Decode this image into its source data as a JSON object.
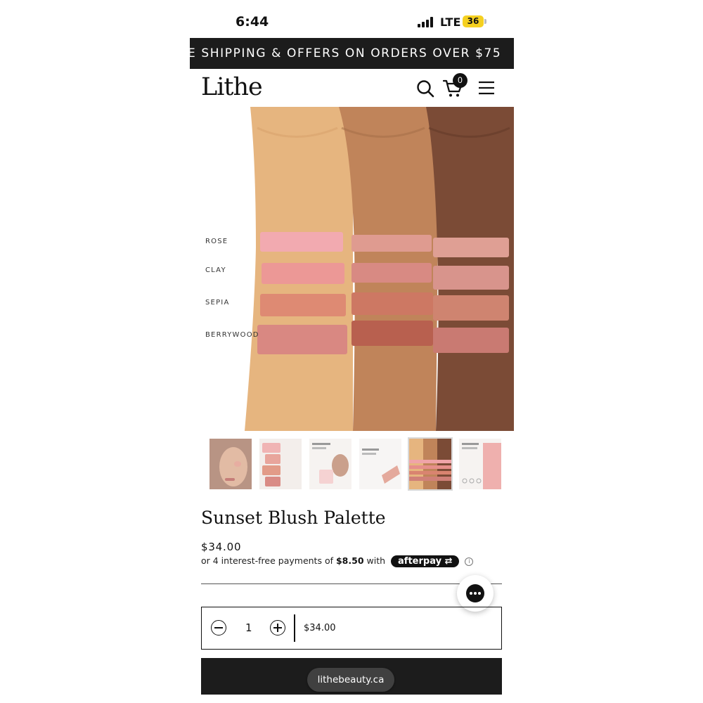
{
  "status_bar": {
    "time": "6:44",
    "network": "LTE",
    "battery": "36"
  },
  "announcement": {
    "text": "E SHIPPING & OFFERS ON ORDERS OVER $75"
  },
  "header": {
    "logo": "Lithe",
    "cart_count": "0"
  },
  "hero": {
    "swatch_labels": [
      "ROSE",
      "CLAY",
      "SEPIA",
      "BERRYWOOD"
    ],
    "colors": {
      "skin_light": "#e6b57f",
      "skin_medium": "#c0845a",
      "skin_deep": "#7b4b36",
      "rose": "#f2aab0",
      "clay": "#ec9896",
      "sepia": "#de8a73",
      "berrywood": "#d98882"
    }
  },
  "product": {
    "title": "Sunset Blush Palette",
    "price": "$34.00",
    "installments_prefix": "or 4 interest-free payments of",
    "installments_amount": "$8.50",
    "installments_with": "with",
    "afterpay_label": "afterpay",
    "info_icon": "ⓘ"
  },
  "quantity": {
    "value": "1",
    "total": "$34.00"
  },
  "browser": {
    "url": "lithebeauty.ca"
  }
}
